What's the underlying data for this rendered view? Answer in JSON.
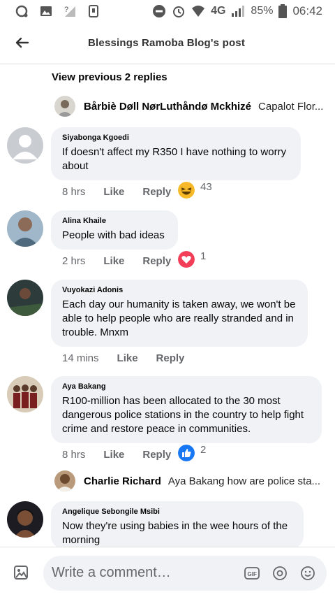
{
  "statusbar": {
    "battery": "85%",
    "network": "4G",
    "time": "06:42"
  },
  "header": {
    "title": "Blessings Ramoba Blog's post"
  },
  "view_previous": "View previous 2 replies",
  "mini_replies": [
    {
      "name": "Bårbiè Døll NørLuthåndø Mckhizé",
      "text": "Capalot Flor..."
    },
    {
      "name": "Charlie Richard",
      "text": "Aya Bakang how are police sta..."
    }
  ],
  "comments": [
    {
      "name": "Siyabonga Kgoedi",
      "lines": [
        "If doesn't affect my R350 I have nothing to worry",
        "about"
      ],
      "time": "8 hrs",
      "like": "Like",
      "reply": "Reply",
      "reaction": "haha",
      "count": "43"
    },
    {
      "name": "Alina Khaile",
      "lines": [
        "People with bad ideas"
      ],
      "time": "2 hrs",
      "like": "Like",
      "reply": "Reply",
      "reaction": "love",
      "count": "1"
    },
    {
      "name": "Vuyokazi Adonis",
      "lines": [
        "Each day our humanity is taken away, we won't be",
        "able to help people who are really stranded and in",
        "trouble. Mnxm"
      ],
      "time": "14 mins",
      "like": "Like",
      "reply": "Reply"
    },
    {
      "name": "Aya Bakang",
      "lines": [
        "R100-million has been allocated to the 30 most",
        "dangerous police stations in the country to help fight",
        "crime and restore peace in communities."
      ],
      "time": "8 hrs",
      "like": "Like",
      "reply": "Reply",
      "reaction": "like",
      "count": "2"
    },
    {
      "name": "Angelique Sebongile Msibi",
      "lines": [
        "Now they're using babies in the wee hours of the",
        "morning"
      ]
    }
  ],
  "composer": {
    "placeholder": "Write a comment…",
    "gif": "GIF"
  },
  "colors": {
    "like_blue": "#1877f2",
    "love_red": "#f33e58",
    "haha_yellow": "#f7b928",
    "bubble": "#f0f2f5"
  }
}
